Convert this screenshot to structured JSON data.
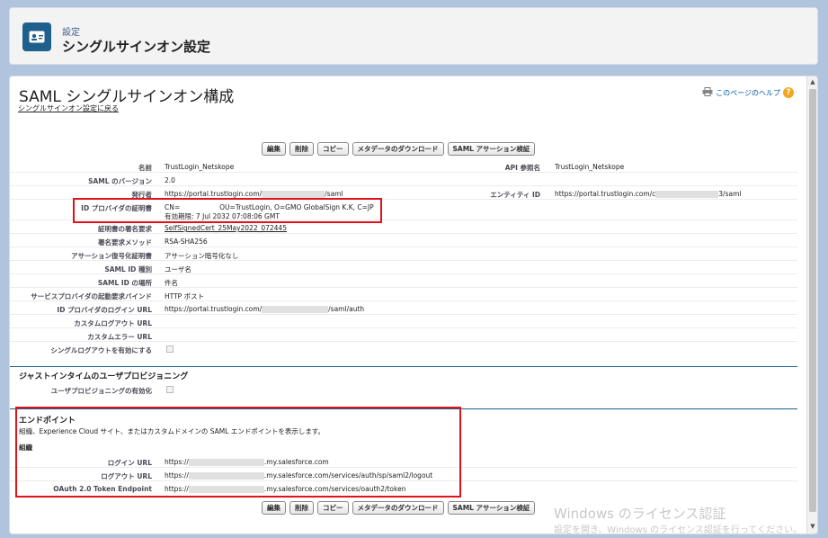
{
  "header": {
    "eyebrow": "設定",
    "title": "シングルサインオン設定"
  },
  "page": {
    "title": "SAML シングルサインオン構成",
    "back_link": "シングルサインオン設定に戻る",
    "help_link": "このページのヘルプ",
    "help_icon": "?"
  },
  "buttons": {
    "edit": "編集",
    "delete": "削除",
    "copy": "コピー",
    "download_metadata": "メタデータのダウンロード",
    "validate_assertion": "SAML アサーション検証"
  },
  "fields": {
    "name_label": "名前",
    "name_value": "TrustLogin_Netskope",
    "api_label": "API 参照名",
    "api_value": "TrustLogin_Netskope",
    "saml_version_label": "SAML のバージョン",
    "saml_version_value": "2.0",
    "issuer_label": "発行者",
    "issuer_prefix": "https://portal.trustlogin.com/",
    "issuer_suffix": "/saml",
    "entity_label": "エンティティ ID",
    "entity_prefix": "https://portal.trustlogin.com/c",
    "entity_suffix": "3/saml",
    "idp_cert_label": "ID プロバイダの証明書",
    "idp_cert_line1_a": "CN=",
    "idp_cert_line1_b": "OU=TrustLogin, O=GMO GlobalSign K.K, C=JP",
    "idp_cert_line2": "有効期限: 7 Jul 2032 07:08:06 GMT",
    "sign_request_label": "証明書の署名要求",
    "sign_request_value": "SelfSignedCert_25May2022_072445",
    "sign_method_label": "署名要求メソッド",
    "sign_method_value": "RSA-SHA256",
    "assertion_decrypt_label": "アサーション復号化証明書",
    "assertion_decrypt_value": "アサーション暗号化なし",
    "saml_id_type_label": "SAML ID 種別",
    "saml_id_type_value": "ユーザ名",
    "saml_id_location_label": "SAML ID の場所",
    "saml_id_location_value": "件名",
    "sp_binding_label": "サービスプロバイダの起動要求バインド",
    "sp_binding_value": "HTTP ポスト",
    "idp_login_label": "ID プロバイダのログイン URL",
    "idp_login_prefix": "https://portal.trustlogin.com/",
    "idp_login_suffix": "/saml/auth",
    "custom_logout_label": "カスタムログアウト URL",
    "custom_error_label": "カスタムエラー URL",
    "single_logout_label": "シングルログアウトを有効にする"
  },
  "jit": {
    "heading": "ジャストインタイムのユーザプロビジョニング",
    "enable_label": "ユーザプロビジョニングの有効化"
  },
  "endpoints": {
    "heading": "エンドポイント",
    "description": "組織、Experience Cloud サイト、またはカスタムドメインの SAML エンドポイントを表示します。",
    "org_label": "組織",
    "login_label": "ログイン URL",
    "login_prefix": "https://",
    "login_suffix": ".my.salesforce.com",
    "logout_label": "ログアウト URL",
    "logout_prefix": "https://",
    "logout_suffix": ".my.salesforce.com/services/auth/sp/saml2/logout",
    "oauth_label": "OAuth 2.0 Token Endpoint",
    "oauth_prefix": "https://",
    "oauth_suffix": ".my.salesforce.com/services/oauth2/token"
  },
  "watermark": {
    "line1": "Windows のライセンス認証",
    "line2": "設定を開き、Windows のライセンス認証を行ってください。"
  },
  "colors": {
    "accent": "#1f5f8b",
    "highlight_box": "#e0121a",
    "page_bg": "#b0c4de"
  }
}
